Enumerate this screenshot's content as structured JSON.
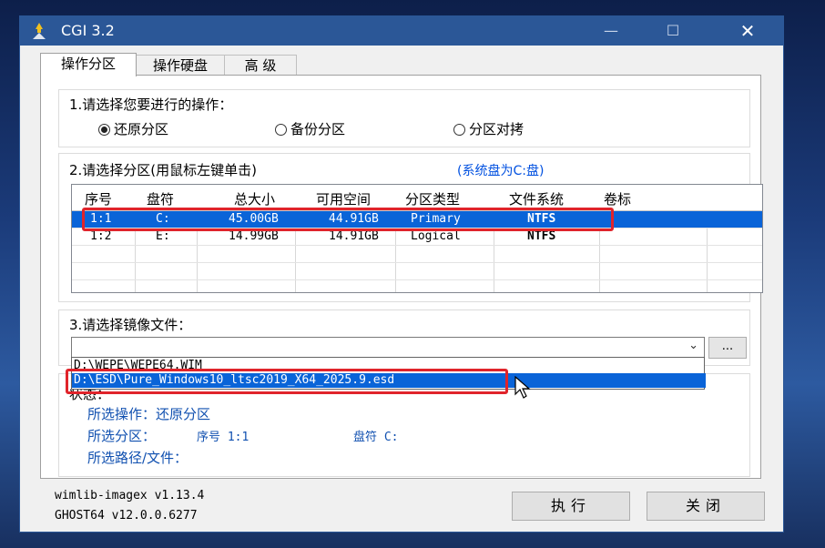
{
  "window": {
    "title": "CGI 3.2"
  },
  "titlebar": {
    "minimize": "—",
    "maximize": "☐",
    "close": "✕"
  },
  "tabs": [
    {
      "label": "操作分区",
      "active": true
    },
    {
      "label": "操作硬盘",
      "active": false
    },
    {
      "label": "高 级",
      "active": false
    }
  ],
  "step1": {
    "label": "1.请选择您要进行的操作：",
    "options": [
      {
        "label": "还原分区",
        "selected": true
      },
      {
        "label": "备份分区",
        "selected": false
      },
      {
        "label": "分区对拷",
        "selected": false
      }
    ]
  },
  "step2": {
    "label": "2.请选择分区(用鼠标左键单击)",
    "hint": "(系统盘为C:盘)",
    "columns": [
      "序号",
      "盘符",
      "总大小",
      "可用空间",
      "分区类型",
      "文件系统",
      "卷标"
    ],
    "rows": [
      {
        "index": "1:1",
        "drive": "C:",
        "total": "45.00GB",
        "free": "44.91GB",
        "type": "Primary",
        "fs": "NTFS",
        "label": "",
        "selected": true
      },
      {
        "index": "1:2",
        "drive": "E:",
        "total": "14.99GB",
        "free": "14.91GB",
        "type": "Logical",
        "fs": "NTFS",
        "label": "",
        "selected": false
      }
    ]
  },
  "step3": {
    "label": "3.请选择镜像文件：",
    "combo_value": "",
    "browse_label": "...",
    "options": [
      {
        "label": "D:\\WEPE\\WEPE64.WIM",
        "selected": false
      },
      {
        "label": "D:\\ESD\\Pure_Windows10_ltsc2019_X64_2025.9.esd",
        "selected": true
      }
    ]
  },
  "status": {
    "label": "状态：",
    "operation": "所选操作：还原分区",
    "partition_label": "所选分区：",
    "partition_index": "序号 1:1",
    "partition_drive": "盘符 C:",
    "path": "所选路径/文件："
  },
  "footer": {
    "wimlib": "wimlib-imagex v1.13.4",
    "ghost": "GHOST64 v12.0.0.6277",
    "execute": "执行",
    "close": "关闭"
  },
  "colors": {
    "titlebar": "#2b5797",
    "selection": "#0a64d8",
    "highlight_box": "#e0242b",
    "hint": "#0050e0"
  }
}
